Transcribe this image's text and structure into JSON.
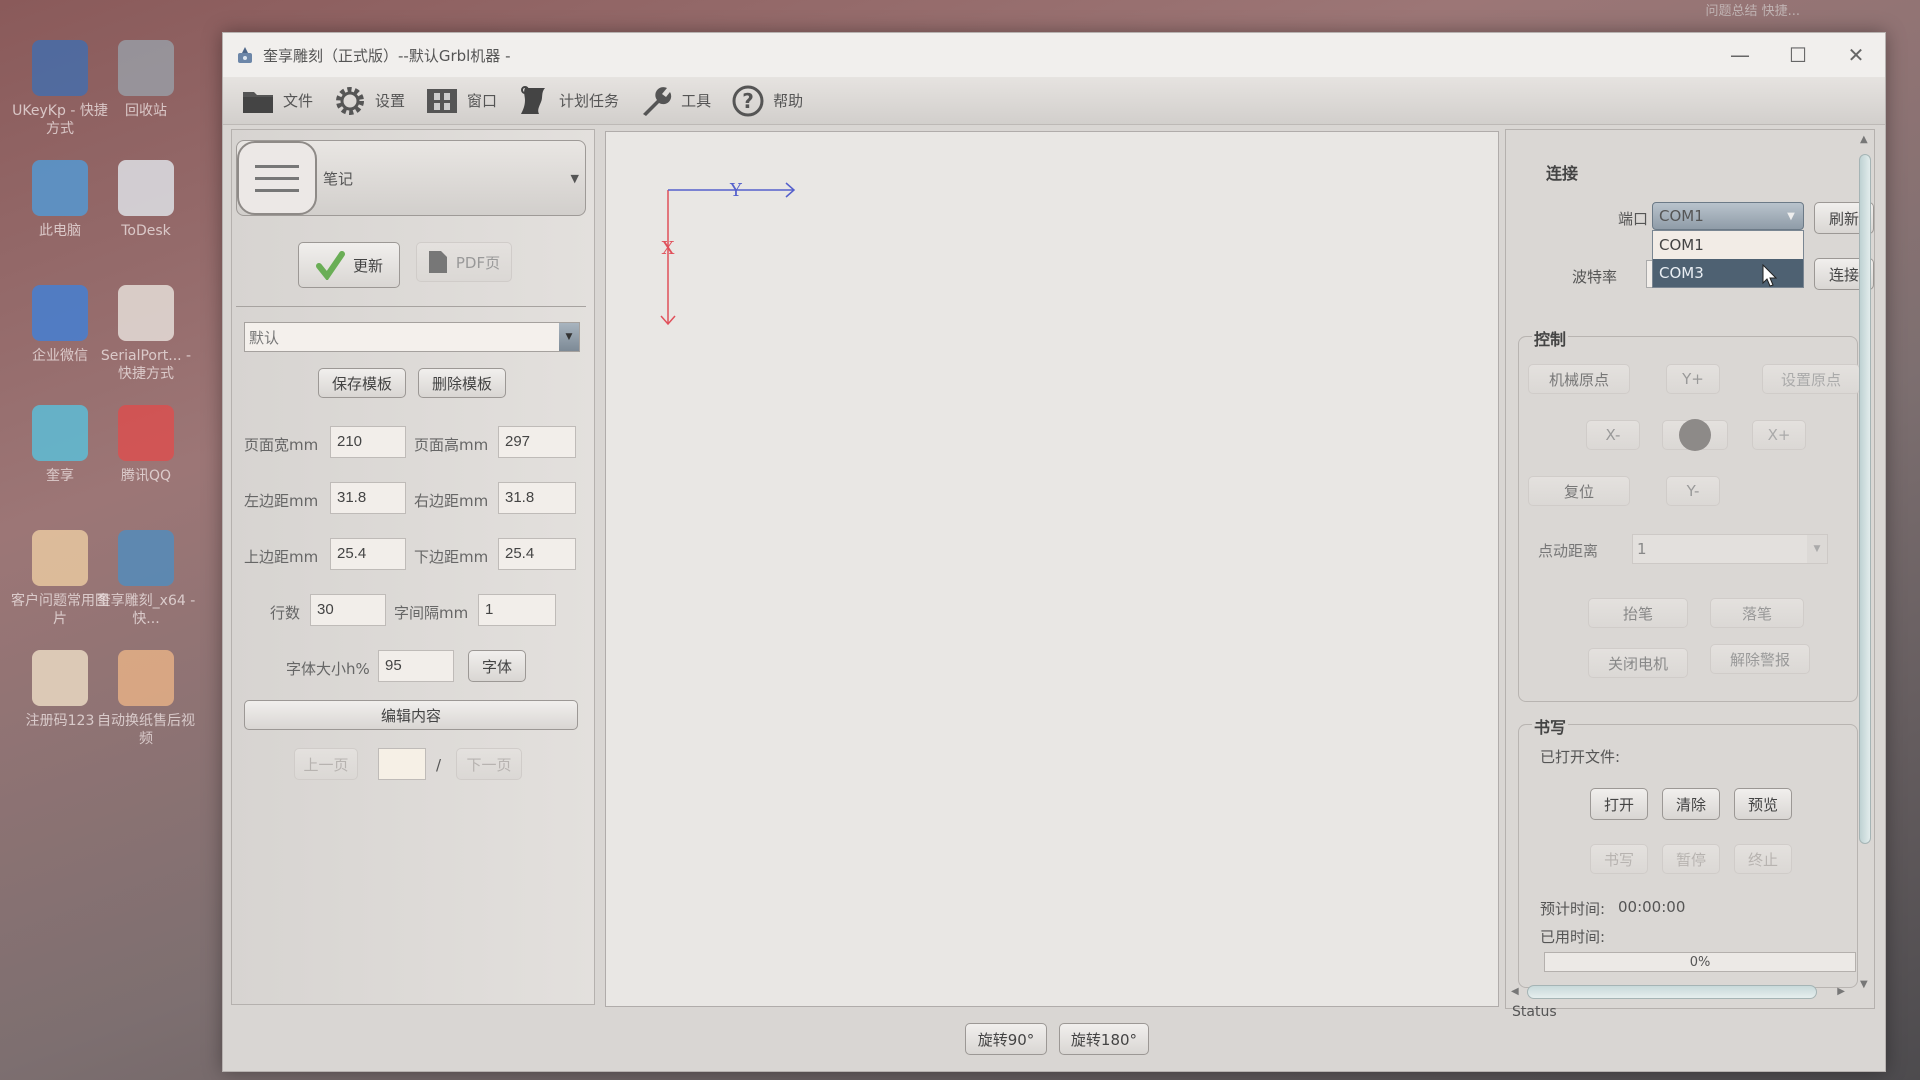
{
  "desktop": {
    "icons": [
      {
        "label": "UKeyKp - 快捷方式",
        "color": "#3d6fb4"
      },
      {
        "label": "回收站",
        "color": "#9aa4ad"
      },
      {
        "label": "此电脑",
        "color": "#4d9fe0"
      },
      {
        "label": "ToDesk",
        "color": "#e8f0f6"
      },
      {
        "label": "企业微信",
        "color": "#3b82e0"
      },
      {
        "label": "SerialPort... - 快捷方式",
        "color": "#f0ece6"
      },
      {
        "label": "奎享",
        "color": "#55c7e4"
      },
      {
        "label": "腾讯QQ",
        "color": "#e34b4b"
      },
      {
        "label": "客户问题常用图片",
        "color": "#f3d3a6"
      },
      {
        "label": "奎享雕刻_x64 - 快...",
        "color": "#4b8fc4"
      },
      {
        "label": "注册码123",
        "color": "#f5e6cc"
      },
      {
        "label": "自动换纸售后视频",
        "color": "#f0b889"
      }
    ],
    "corner_text": "问题总结    快捷..."
  },
  "window": {
    "title": "奎享雕刻（正式版）--默认Grbl机器 -",
    "controls": {
      "minimize": "—",
      "maximize": "☐",
      "close": "✕"
    }
  },
  "toolbar": {
    "items": [
      {
        "label": "文件",
        "icon": "folder-icon"
      },
      {
        "label": "设置",
        "icon": "gear-icon"
      },
      {
        "label": "窗口",
        "icon": "window-icon"
      },
      {
        "label": "计划任务",
        "icon": "scroll-icon"
      },
      {
        "label": "工具",
        "icon": "wrench-icon"
      },
      {
        "label": "帮助",
        "icon": "help-icon"
      }
    ]
  },
  "left_panel": {
    "mode_select": "笔记",
    "update_button": "更新",
    "pdf_button": "PDF页",
    "template_select": "默认",
    "save_template": "保存模板",
    "delete_template": "删除模板",
    "fields": {
      "page_width": {
        "label": "页面宽mm",
        "value": "210"
      },
      "page_height": {
        "label": "页面高mm",
        "value": "297"
      },
      "left_margin": {
        "label": "左边距mm",
        "value": "31.8"
      },
      "right_margin": {
        "label": "右边距mm",
        "value": "31.8"
      },
      "top_margin": {
        "label": "上边距mm",
        "value": "25.4"
      },
      "bottom_margin": {
        "label": "下边距mm",
        "value": "25.4"
      },
      "rows": {
        "label": "行数",
        "value": "30"
      },
      "char_spacing": {
        "label": "字间隔mm",
        "value": "1"
      },
      "font_size": {
        "label": "字体大小h%",
        "value": "95"
      }
    },
    "font_button": "字体",
    "edit_content": "编辑内容",
    "prev_page": "上一页",
    "page_input": "",
    "page_separator": "/",
    "next_page": "下一页"
  },
  "canvas": {
    "axis_x_label": "X",
    "axis_y_label": "Y",
    "axis_x_color": "#e0505a",
    "axis_y_color": "#5560cc"
  },
  "bottom_bar": {
    "rotate90": "旋转90°",
    "rotate180": "旋转180°"
  },
  "right_panel": {
    "connect": {
      "title": "连接",
      "port_label": "端口",
      "port_value": "COM1",
      "port_options": [
        "COM1",
        "COM3"
      ],
      "port_highlighted": "COM3",
      "refresh": "刷新",
      "baud_label": "波特率",
      "connect_button": "连接"
    },
    "control": {
      "title": "控制",
      "home": "机械原点",
      "y_plus": "Y+",
      "set_origin": "设置原点",
      "x_minus": "X-",
      "x_plus": "X+",
      "reset": "复位",
      "y_minus": "Y-",
      "jog_label": "点动距离",
      "jog_value": "1",
      "pen_up": "抬笔",
      "pen_down": "落笔",
      "motor_off": "关闭电机",
      "clear_alarm": "解除警报"
    },
    "write": {
      "title": "书写",
      "opened_file_label": "已打开文件:",
      "open": "打开",
      "clear": "清除",
      "preview": "预览",
      "write": "书写",
      "pause": "暂停",
      "stop": "终止",
      "estimated_label": "预计时间:",
      "estimated_value": "00:00:00",
      "elapsed_label": "已用时间:",
      "progress": 0,
      "progress_text": "0%"
    },
    "status_label": "Status"
  }
}
